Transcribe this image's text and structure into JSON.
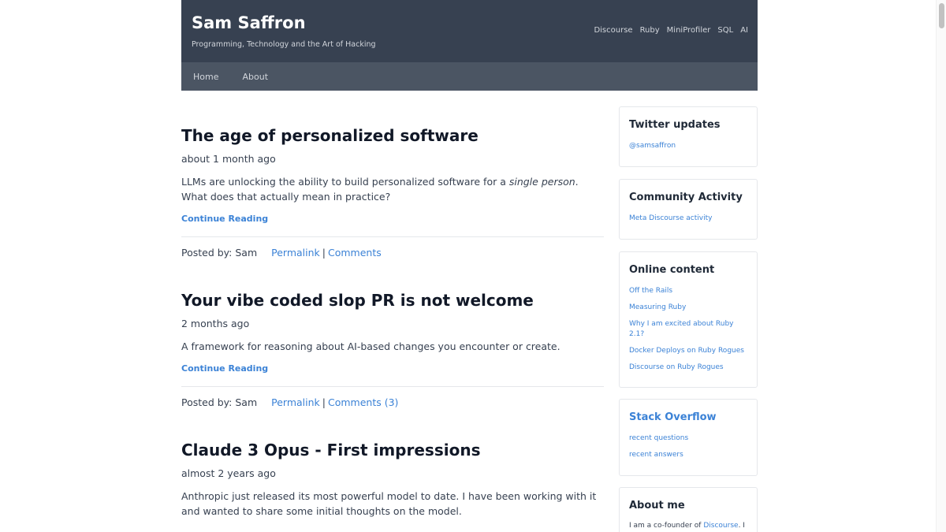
{
  "site": {
    "title": "Sam Saffron",
    "tagline": "Programming, Technology and the Art of Hacking",
    "top_links": [
      "Discourse",
      "Ruby",
      "MiniProfiler",
      "SQL",
      "AI"
    ]
  },
  "nav": {
    "home": "Home",
    "about": "About"
  },
  "posts": [
    {
      "title": "The age of personalized software",
      "date": "about 1 month ago",
      "excerpt_before": "LLMs are unlocking the ability to build personalized software for a ",
      "excerpt_em": "single person",
      "excerpt_after": ". What does that actually mean in practice?",
      "continue": "Continue Reading",
      "posted_by": "Posted by: Sam",
      "permalink": "Permalink",
      "separator": "|",
      "comments": "Comments"
    },
    {
      "title": "Your vibe coded slop PR is not welcome",
      "date": "2 months ago",
      "excerpt": "A framework for reasoning about AI-based changes you encounter or create.",
      "continue": "Continue Reading",
      "posted_by": "Posted by: Sam",
      "permalink": "Permalink",
      "separator": "|",
      "comments": "Comments (3)"
    },
    {
      "title": "Claude 3 Opus - First impressions",
      "date": "almost 2 years ago",
      "excerpt": "Anthropic just released its most powerful model to date. I have been working with it and wanted to share some initial thoughts on the model."
    }
  ],
  "sidebar": {
    "twitter": {
      "title": "Twitter updates",
      "link": "@samsaffron"
    },
    "community": {
      "title": "Community Activity",
      "link": "Meta Discourse activity"
    },
    "online": {
      "title": "Online content",
      "links": [
        "Off the Rails",
        "Measuring Ruby",
        "Why I am excited about Ruby 2.1?",
        "Docker Deploys on Ruby Rogues",
        "Discourse on Ruby Rogues"
      ]
    },
    "stackoverflow": {
      "title": "Stack Overflow",
      "links": [
        "recent questions",
        "recent answers"
      ]
    },
    "about": {
      "title": "About me",
      "text_before": "I am a co-founder of ",
      "link": "Discourse",
      "text_after": ". I"
    }
  },
  "colors": {
    "header_bg": "#374151",
    "nav_bg": "#4b5563",
    "link": "#3b82d6"
  }
}
